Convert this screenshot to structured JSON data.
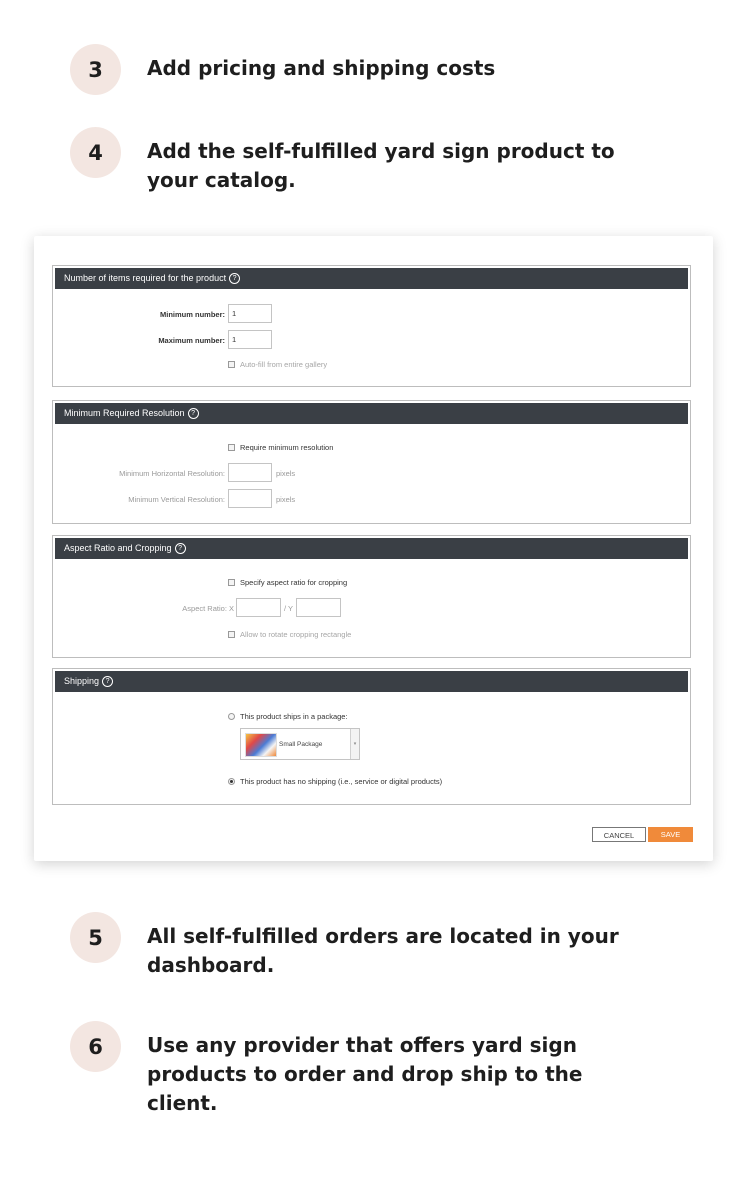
{
  "steps_top": [
    {
      "number": "3",
      "text": "Add pricing and shipping costs"
    },
    {
      "number": "4",
      "text": "Add the self-fulfilled yard sign product to your catalog."
    }
  ],
  "steps_bottom": [
    {
      "number": "5",
      "text": "All self-fulfilled orders are located in your dashboard."
    },
    {
      "number": "6",
      "text": "Use any provider that offers yard sign products to order and drop ship to the client."
    }
  ],
  "items_section": {
    "title": "Number of items required for the product",
    "min_label": "Minimum number:",
    "min_value": "1",
    "max_label": "Maximum number:",
    "max_value": "1",
    "autofill_label": "Auto-fill from entire gallery"
  },
  "resolution_section": {
    "title": "Minimum Required Resolution",
    "require_label": "Require minimum resolution",
    "horizontal_label": "Minimum Horizontal Resolution:",
    "vertical_label": "Minimum Vertical Resolution:",
    "unit": "pixels"
  },
  "aspect_section": {
    "title": "Aspect Ratio and Cropping",
    "specify_label": "Specify aspect ratio for cropping",
    "ratio_label": "Aspect Ratio: X",
    "y_label": "/ Y",
    "rotate_label": "Allow to rotate cropping rectangle"
  },
  "shipping_section": {
    "title": "Shipping",
    "ships_label": "This product ships in a package:",
    "package_option": "Small Package",
    "no_shipping_label": "This product has no shipping (i.e., service or digital products)"
  },
  "buttons": {
    "cancel": "CANCEL",
    "save": "SAVE"
  },
  "help_glyph": "?",
  "caret_glyph": "▾",
  "colors": {
    "header": "#3a3f45",
    "save": "#f08a3a",
    "step_circle": "#f3e6e1"
  }
}
